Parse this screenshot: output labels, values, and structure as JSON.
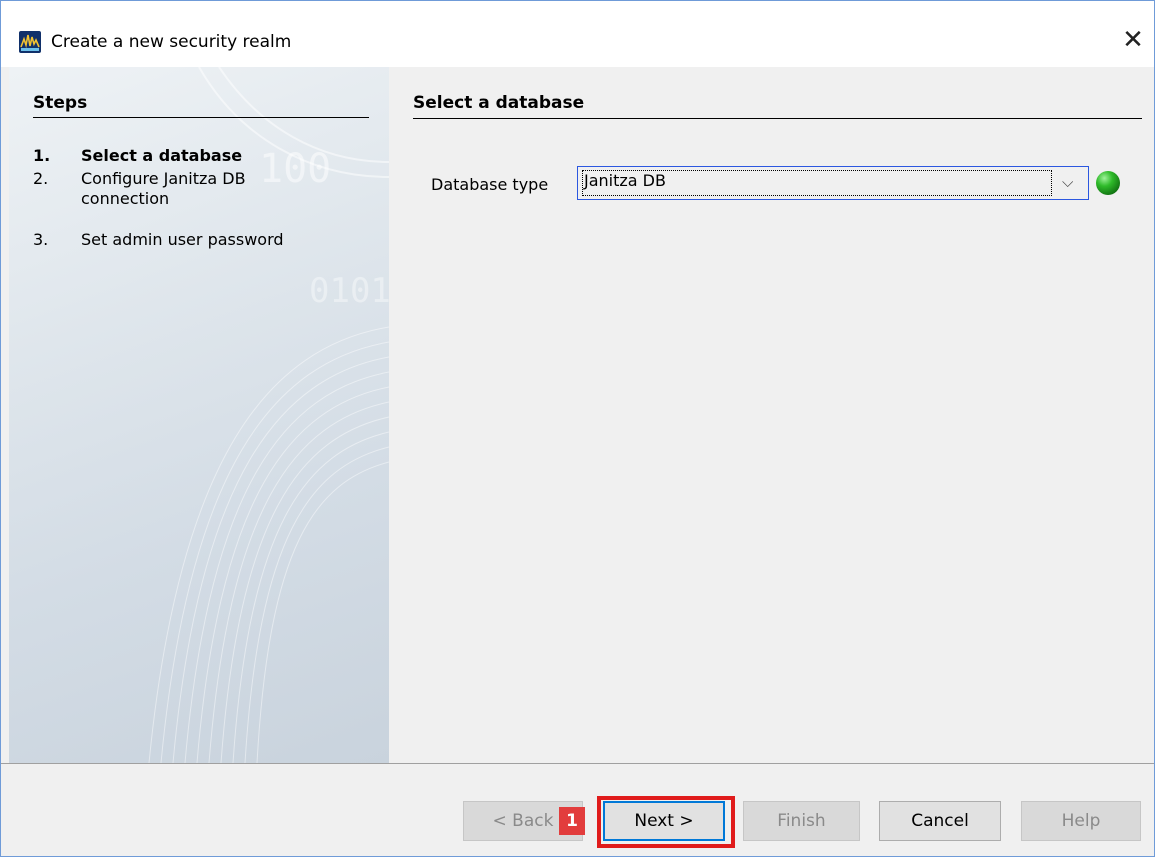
{
  "window": {
    "title": "Create a new security realm",
    "close_glyph": "✕"
  },
  "steps": {
    "heading": "Steps",
    "items": [
      {
        "number": "1.",
        "label": "Select a database",
        "active": true
      },
      {
        "number": "2.",
        "label": "Configure Janitza DB connection",
        "active": false
      },
      {
        "number": "3.",
        "label": "Set admin user password",
        "active": false
      }
    ]
  },
  "main": {
    "section_title": "Select a database",
    "database_type": {
      "label": "Database type",
      "selected": "Janitza DB",
      "status_color": "#2fbb2a"
    }
  },
  "buttons": {
    "back": "< Back",
    "next": "Next >",
    "finish": "Finish",
    "cancel": "Cancel",
    "help": "Help"
  },
  "annotation": {
    "marker": "1",
    "highlight_color": "#e01b1b"
  },
  "icons": {
    "app": "app-logo-icon",
    "close": "close-icon",
    "dropdown": "chevron-down-icon",
    "status": "status-indicator-icon"
  }
}
